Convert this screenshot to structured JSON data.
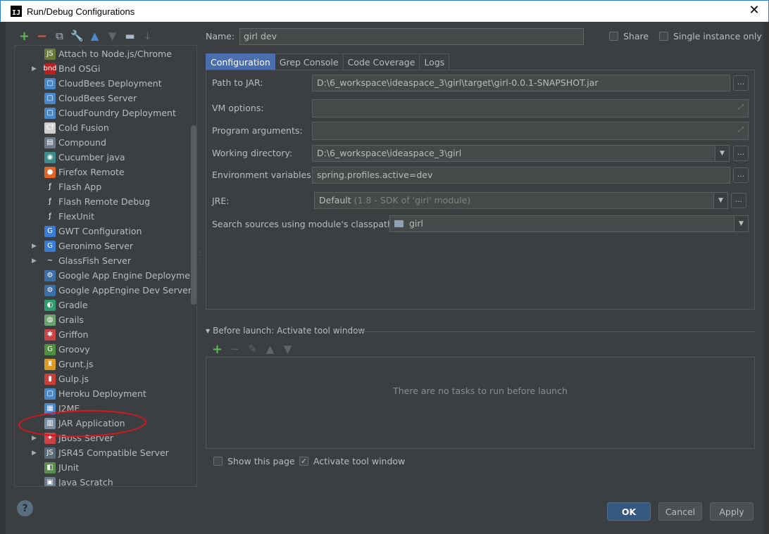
{
  "window": {
    "title": "Run/Debug Configurations",
    "app_icon_text": "IJ",
    "close_glyph": "✕"
  },
  "toolbar": [
    {
      "name": "add-icon",
      "glyph": "+",
      "cls": "green"
    },
    {
      "name": "remove-icon",
      "glyph": "−",
      "cls": "red"
    },
    {
      "name": "copy-icon",
      "glyph": "⧉",
      "cls": "light"
    },
    {
      "name": "edit-defaults-icon",
      "glyph": "🔧",
      "cls": "light"
    },
    {
      "name": "move-up-icon",
      "glyph": "▲",
      "cls": "blue"
    },
    {
      "name": "move-down-icon",
      "glyph": "▼",
      "cls": "gray"
    },
    {
      "name": "folder-icon",
      "glyph": "▬",
      "cls": "light"
    },
    {
      "name": "sort-icon",
      "glyph": "↓",
      "cls": "gray"
    }
  ],
  "tree": [
    {
      "label": "Attach to Node.js/Chrome",
      "icon": "JS",
      "color": "#6b7b3a",
      "arrow": ""
    },
    {
      "label": "Bnd OSGi",
      "icon": "bnd",
      "color": "#b22222",
      "arrow": "▶"
    },
    {
      "label": "CloudBees Deployment",
      "icon": "▢",
      "color": "#4a88c7",
      "arrow": ""
    },
    {
      "label": "CloudBees Server",
      "icon": "▢",
      "color": "#4a88c7",
      "arrow": ""
    },
    {
      "label": "CloudFoundry Deployment",
      "icon": "▢",
      "color": "#4a88c7",
      "arrow": ""
    },
    {
      "label": "Cold Fusion",
      "icon": "Cf",
      "color": "#d0d0d0",
      "arrow": ""
    },
    {
      "label": "Compound",
      "icon": "▤",
      "color": "#6e7c8a",
      "arrow": ""
    },
    {
      "label": "Cucumber java",
      "icon": "◉",
      "color": "#3d8c8c",
      "arrow": ""
    },
    {
      "label": "Firefox Remote",
      "icon": "●",
      "color": "#e0662a",
      "arrow": ""
    },
    {
      "label": "Flash App",
      "icon": "ƒ",
      "color": "#3c3f41",
      "arrow": ""
    },
    {
      "label": "Flash Remote Debug",
      "icon": "ƒ",
      "color": "#3c3f41",
      "arrow": ""
    },
    {
      "label": "FlexUnit",
      "icon": "ƒ",
      "color": "#3c3f41",
      "arrow": ""
    },
    {
      "label": "GWT Configuration",
      "icon": "G",
      "color": "#3b7bd4",
      "arrow": ""
    },
    {
      "label": "Geronimo Server",
      "icon": "G",
      "color": "#3b7bd4",
      "arrow": "▶"
    },
    {
      "label": "GlassFish Server",
      "icon": "~",
      "color": "#3c3f41",
      "arrow": "▶"
    },
    {
      "label": "Google App Engine Deployment",
      "icon": "⚙",
      "color": "#3c6ea8",
      "arrow": ""
    },
    {
      "label": "Google AppEngine Dev Server",
      "icon": "⚙",
      "color": "#3c6ea8",
      "arrow": ""
    },
    {
      "label": "Gradle",
      "icon": "◐",
      "color": "#2f9e6e",
      "arrow": ""
    },
    {
      "label": "Grails",
      "icon": "◍",
      "color": "#6da36d",
      "arrow": ""
    },
    {
      "label": "Griffon",
      "icon": "✱",
      "color": "#c94444",
      "arrow": ""
    },
    {
      "label": "Groovy",
      "icon": "G",
      "color": "#4f8f3f",
      "arrow": ""
    },
    {
      "label": "Grunt.js",
      "icon": "♜",
      "color": "#d99a26",
      "arrow": ""
    },
    {
      "label": "Gulp.js",
      "icon": "▮",
      "color": "#c9403a",
      "arrow": ""
    },
    {
      "label": "Heroku Deployment",
      "icon": "▢",
      "color": "#4a88c7",
      "arrow": ""
    },
    {
      "label": "J2ME",
      "icon": "▦",
      "color": "#4a88c7",
      "arrow": ""
    },
    {
      "label": "JAR Application",
      "icon": "▥",
      "color": "#7a8fa3",
      "arrow": ""
    },
    {
      "label": "JBoss Server",
      "icon": "✦",
      "color": "#c94444",
      "arrow": "▶"
    },
    {
      "label": "JSR45 Compatible Server",
      "icon": "JS",
      "color": "#5c6b7a",
      "arrow": "▶"
    },
    {
      "label": "JUnit",
      "icon": "◧",
      "color": "#5b8e4f",
      "arrow": ""
    },
    {
      "label": "Java Scratch",
      "icon": "▣",
      "color": "#6e7c8a",
      "arrow": ""
    }
  ],
  "form": {
    "name_label": "Name:",
    "name_value": "girl dev",
    "share_label": "Share",
    "single_instance_label": "Single instance only",
    "tabs": [
      "Configuration",
      "Grep Console",
      "Code Coverage",
      "Logs"
    ],
    "path_label": "Path to JAR:",
    "path_value": "D:\\6_workspace\\ideaspace_3\\girl\\target\\girl-0.0.1-SNAPSHOT.jar",
    "vm_label": "VM options:",
    "vm_value": "",
    "args_label": "Program arguments:",
    "args_value": "",
    "workdir_label": "Working directory:",
    "workdir_value": "D:\\6_workspace\\ideaspace_3\\girl",
    "env_label": "Environment variables:",
    "env_value": "spring.profiles.active=dev",
    "jre_label": "JRE:",
    "jre_value": "Default",
    "jre_hint": "(1.8 - SDK of 'girl' module)",
    "classpath_label": "Search sources using module's classpath:",
    "classpath_value": "girl",
    "browse_glyph": "...",
    "expand_glyph": "⤢",
    "dropdown_glyph": "▼"
  },
  "before_launch": {
    "title": "Before launch: Activate tool window",
    "collapse_glyph": "▼",
    "empty_text": "There are no tasks to run before launch",
    "toolbar": [
      {
        "name": "add-task-icon",
        "glyph": "+",
        "cls": "green"
      },
      {
        "name": "remove-task-icon",
        "glyph": "−",
        "cls": "gray"
      },
      {
        "name": "edit-task-icon",
        "glyph": "✎",
        "cls": "gray"
      },
      {
        "name": "move-task-up-icon",
        "glyph": "▲",
        "cls": "gray"
      },
      {
        "name": "move-task-down-icon",
        "glyph": "▼",
        "cls": "gray"
      }
    ]
  },
  "options": {
    "show_page_label": "Show this page",
    "show_page_checked": false,
    "activate_label": "Activate tool window",
    "activate_checked": true,
    "check_glyph": "✓"
  },
  "buttons": {
    "help_glyph": "?",
    "ok": "OK",
    "cancel": "Cancel",
    "apply": "Apply"
  },
  "colors": {
    "accent": "#4b6eaf",
    "background": "#3c3f41",
    "annotation": "#e0141e"
  }
}
